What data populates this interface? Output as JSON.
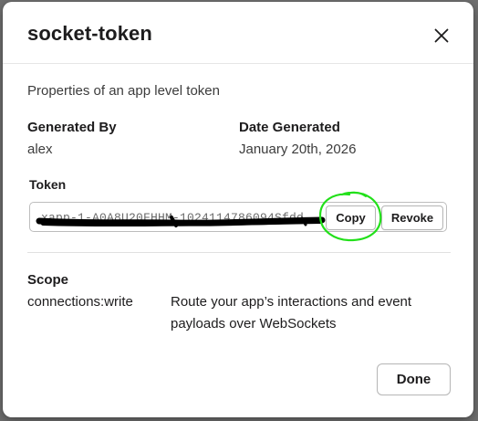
{
  "modal": {
    "title": "socket-token",
    "subtitle": "Properties of an app level token",
    "close_icon": "close-icon"
  },
  "generated_by": {
    "label": "Generated By",
    "value": "alex"
  },
  "date_generated": {
    "label": "Date Generated",
    "value": "January 20th, 2026"
  },
  "token": {
    "label": "Token",
    "value": "xapp-1-A0A8U20FHHM-1024114786094Sfdd...dd",
    "redacted": true,
    "copy_label": "Copy",
    "revoke_label": "Revoke"
  },
  "scope": {
    "label": "Scope",
    "name": "connections:write",
    "description_line1": "Route your app’s interactions and event",
    "description_line2": "payloads over WebSockets"
  },
  "footer": {
    "done_label": "Done"
  },
  "colors": {
    "annotation": "#22e01a",
    "redaction": "#000000",
    "backdrop": "#6f6f6f"
  }
}
